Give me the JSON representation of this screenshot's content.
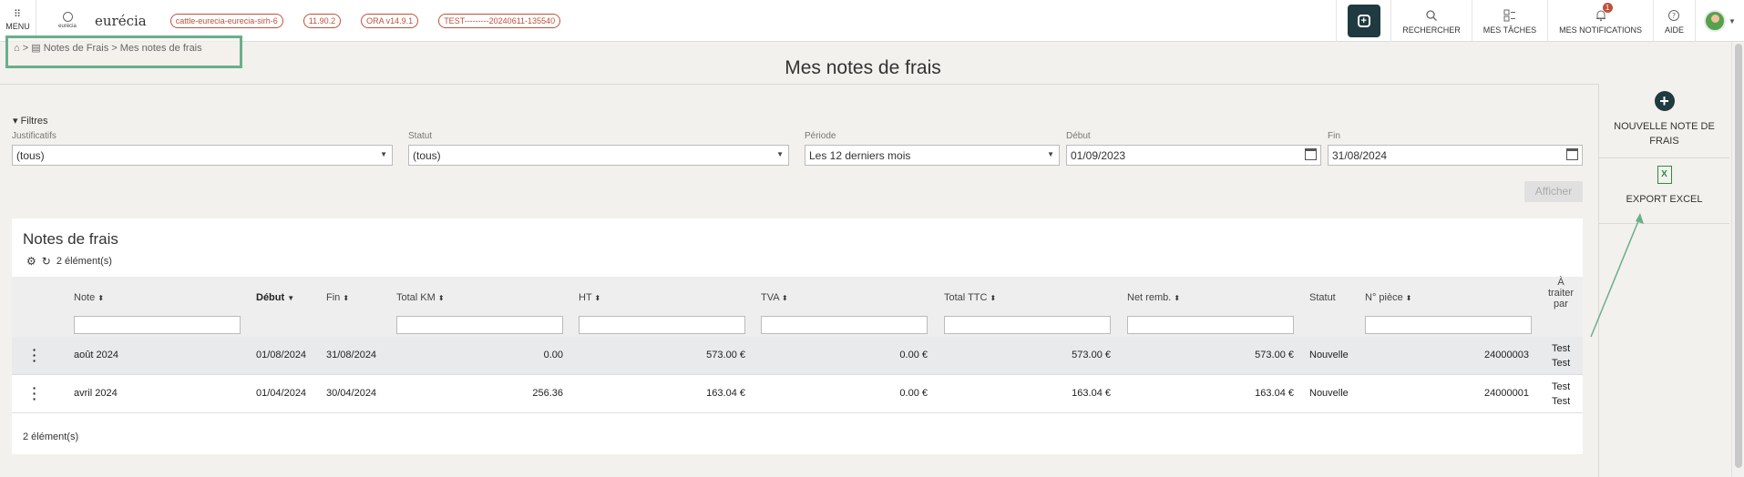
{
  "topbar": {
    "menu_label": "MENU",
    "small_logo_text": "eurécia",
    "brand": "eurécia",
    "tags": [
      "cattle-eurecia-eurecia-sirh-6",
      "11.90.2",
      "ORA v14.9.1",
      "TEST---------20240611-135540"
    ],
    "buttons": [
      {
        "label": "RECHERCHER",
        "icon": "search-icon"
      },
      {
        "label": "MES TÂCHES",
        "icon": "tasks-icon"
      },
      {
        "label": "MES NOTIFICATIONS",
        "icon": "bell-icon",
        "badge": "1"
      },
      {
        "label": "AIDE",
        "icon": "help-icon"
      }
    ]
  },
  "breadcrumb": {
    "home": "⌂",
    "sep": ">",
    "doc_icon": "▤",
    "path": "Notes de Frais > Mes notes de frais"
  },
  "page_title": "Mes notes de frais",
  "side_actions": {
    "new_note": "NOUVELLE NOTE DE FRAIS",
    "export": "EXPORT EXCEL"
  },
  "filters": {
    "toggle": "▾ Filtres",
    "justificatifs": {
      "label": "Justificatifs",
      "value": "(tous)"
    },
    "statut": {
      "label": "Statut",
      "value": "(tous)"
    },
    "periode": {
      "label": "Période",
      "value": "Les 12 derniers mois"
    },
    "debut": {
      "label": "Début",
      "value": "01/09/2023"
    },
    "fin": {
      "label": "Fin",
      "value": "31/08/2024"
    },
    "afficher": "Afficher"
  },
  "table": {
    "title": "Notes de frais",
    "count": "2 élément(s)",
    "columns": {
      "note": "Note",
      "debut": "Début",
      "fin": "Fin",
      "total_km": "Total KM",
      "ht": "HT",
      "tva": "TVA",
      "total_ttc": "Total TTC",
      "net_remb": "Net remb.",
      "statut": "Statut",
      "piece": "N° pièce",
      "a_traiter_1": "À",
      "a_traiter_2": "traiter",
      "a_traiter_3": "par"
    },
    "rows": [
      {
        "note": "août 2024",
        "debut": "01/08/2024",
        "fin": "31/08/2024",
        "total_km": "0.00",
        "ht": "573.00 €",
        "tva": "0.00 €",
        "total_ttc": "573.00 €",
        "net_remb": "573.00 €",
        "statut": "Nouvelle",
        "piece": "24000003",
        "par_1": "Test",
        "par_2": "Test"
      },
      {
        "note": "avril 2024",
        "debut": "01/04/2024",
        "fin": "30/04/2024",
        "total_km": "256.36",
        "ht": "163.04 €",
        "tva": "0.00 €",
        "total_ttc": "163.04 €",
        "net_remb": "163.04 €",
        "statut": "Nouvelle",
        "piece": "24000001",
        "par_1": "Test",
        "par_2": "Test"
      }
    ],
    "footer_count": "2 élément(s)"
  },
  "colors": {
    "accent_dark": "#1f3a40",
    "tag_red": "#c0503a",
    "highlight_green": "#6aaf8a"
  }
}
